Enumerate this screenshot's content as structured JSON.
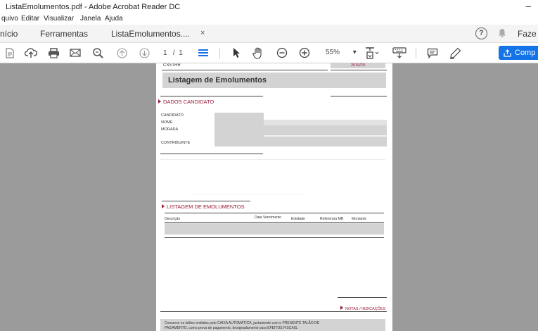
{
  "window": {
    "title": "ListaEmolumentos.pdf - Adobe Acrobat Reader DC",
    "minimize": "–"
  },
  "menu": [
    "quivo",
    "Editar",
    "Visualizar",
    "Janela",
    "Ajuda"
  ],
  "tabs": {
    "home": "nício",
    "tools": "Ferramentas",
    "document": "ListaEmolumentos....",
    "close": "×",
    "help": "?",
    "signin": "Faze"
  },
  "toolbar": {
    "page_current": "1",
    "page_sep": "/",
    "page_total": "1",
    "zoom": "55%",
    "share_label": "Comp",
    "icons": [
      "create-pdf-icon",
      "upload-icon",
      "print-icon",
      "email-icon",
      "zoom-search-icon",
      "prev-page-icon",
      "next-page-icon",
      "page-thumbnails-icon",
      "select-cursor-icon",
      "hand-icon",
      "zoom-out-icon",
      "zoom-in-icon",
      "fit-page-icon",
      "keyboard-icon",
      "comment-icon",
      "pen-icon"
    ],
    "accent": "#1473e6"
  },
  "document": {
    "header_left": "CSSTRR",
    "header_right": "2019/20",
    "title": "Listagem de Emolumentos",
    "section1": "DADOS CANDIDATO",
    "fields": [
      "CANDIDATO",
      "NOME",
      "MORADA",
      "CONTRIBUINTE"
    ],
    "section2": "LISTAGEM DE EMOLUMENTOS",
    "columns": [
      "Descrição",
      "Data Vencimento",
      "Entidade",
      "Referencia MB",
      "Montante"
    ],
    "notes": "NOTAS / INDICAÇÕES",
    "footer_line1": "Conserve os talões emitidos pelo CAIXA AUTOMÁTICA, juntamente com o PRESENTE TALÃO DE",
    "footer_line2": "PAGAMENTO, como prova de pagamento, designadamente para EFEITOS FISCAIS.",
    "accent": "#9a1b3a"
  }
}
